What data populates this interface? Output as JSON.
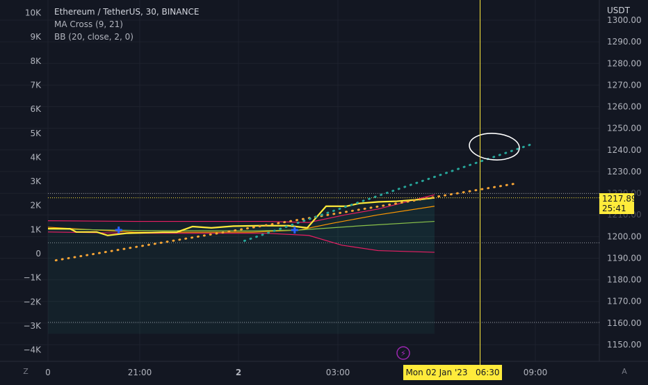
{
  "legend": {
    "symbol": "Ethereum / TetherUS, 30, BINANCE",
    "indicators": [
      "MA Cross (9, 21)",
      "BB (20, close, 2, 0)"
    ]
  },
  "currency": "USDT",
  "price_tag": {
    "price": "1217.89",
    "countdown": "25:41"
  },
  "crosshair_time_label": "Mon 02 Jan '23   06:30",
  "corner_left": "Z",
  "corner_right": "A",
  "colors": {
    "background": "#131722",
    "price_line": "#ffeb3b",
    "bb_band": "#e91e63",
    "ma_fast": "#ff9800",
    "ma_slow": "#8bc34a",
    "trend_orange": "#f7a535",
    "trend_teal": "#26a69a",
    "cross_marker": "#2962ff",
    "lightning": "#9c27b0"
  },
  "chart_data": {
    "type": "line",
    "left_axis_labels": [
      "10K",
      "9K",
      "8K",
      "7K",
      "6K",
      "5K",
      "4K",
      "3K",
      "2K",
      "1K",
      "0",
      "−1K",
      "−2K",
      "−3K",
      "−4K"
    ],
    "right_axis_labels": [
      "1300.00",
      "1290.00",
      "1280.00",
      "1270.00",
      "1260.00",
      "1250.00",
      "1240.00",
      "1230.00",
      "1220.00",
      "1210.00",
      "1200.00",
      "1190.00",
      "1180.00",
      "1170.00",
      "1160.00",
      "1150.00"
    ],
    "x_tick_labels": [
      "0",
      "21:00",
      "2",
      "03:00",
      "09:00"
    ],
    "price_series": [
      {
        "t": 0,
        "v": 1203.6
      },
      {
        "t": 1.4,
        "v": 1203.6
      },
      {
        "t": 1.8,
        "v": 1202.1
      },
      {
        "t": 3.1,
        "v": 1202.1
      },
      {
        "t": 3.8,
        "v": 1200.5
      },
      {
        "t": 5.0,
        "v": 1201.5
      },
      {
        "t": 7.3,
        "v": 1202.0
      },
      {
        "t": 8.2,
        "v": 1202.0
      },
      {
        "t": 9.2,
        "v": 1204.6
      },
      {
        "t": 10.4,
        "v": 1204.0
      },
      {
        "t": 11.8,
        "v": 1204.8
      },
      {
        "t": 13.6,
        "v": 1205.0
      },
      {
        "t": 15.3,
        "v": 1205.0
      },
      {
        "t": 16.5,
        "v": 1204.0
      },
      {
        "t": 17.7,
        "v": 1214.0
      },
      {
        "t": 19.0,
        "v": 1214.0
      },
      {
        "t": 19.8,
        "v": 1215.3
      },
      {
        "t": 21.0,
        "v": 1216.0
      },
      {
        "t": 22.2,
        "v": 1216.3
      },
      {
        "t": 23.5,
        "v": 1217.0
      },
      {
        "t": 24.6,
        "v": 1217.9
      }
    ],
    "bb_upper": [
      [
        0,
        1207.3
      ],
      [
        5.5,
        1207.0
      ],
      [
        13.9,
        1207.0
      ],
      [
        16.6,
        1206.5
      ],
      [
        18.9,
        1210.0
      ],
      [
        21.0,
        1212.7
      ],
      [
        24.6,
        1219.3
      ]
    ],
    "bb_lower": [
      [
        0,
        1202.1
      ],
      [
        5.5,
        1201.5
      ],
      [
        13.9,
        1201.5
      ],
      [
        16.6,
        1200.5
      ],
      [
        18.7,
        1196.0
      ],
      [
        21.0,
        1193.5
      ],
      [
        24.6,
        1192.7
      ]
    ],
    "ma_fast": [
      [
        0,
        1204.3
      ],
      [
        5.5,
        1202.0
      ],
      [
        13.0,
        1202.0
      ],
      [
        16.0,
        1203.0
      ],
      [
        18.0,
        1206.0
      ],
      [
        21.0,
        1210.0
      ],
      [
        24.6,
        1214.0
      ]
    ],
    "ma_slow": [
      [
        0,
        1203.5
      ],
      [
        5.5,
        1202.8
      ],
      [
        13.0,
        1202.6
      ],
      [
        16.0,
        1203.0
      ],
      [
        20.0,
        1205.0
      ],
      [
        24.6,
        1207.0
      ]
    ],
    "cross_markers": [
      [
        4.5,
        1203.0
      ],
      [
        15.7,
        1203.0
      ]
    ],
    "trend_orange": [
      [
        0.5,
        1189.0
      ],
      [
        29.7,
        1224.4
      ]
    ],
    "trend_teal": [
      [
        12.5,
        1198.0
      ],
      [
        30.8,
        1242.7
      ]
    ],
    "crosshair_t": 27.5,
    "current_price": 1217.89,
    "horizontal_levels": [
      1219.9,
      1197.1,
      1160.3
    ],
    "right_axis_range": [
      1145,
      1305
    ],
    "left_axis_range": [
      -4000,
      10000
    ],
    "annotation": "circle drawing around trend line end"
  }
}
